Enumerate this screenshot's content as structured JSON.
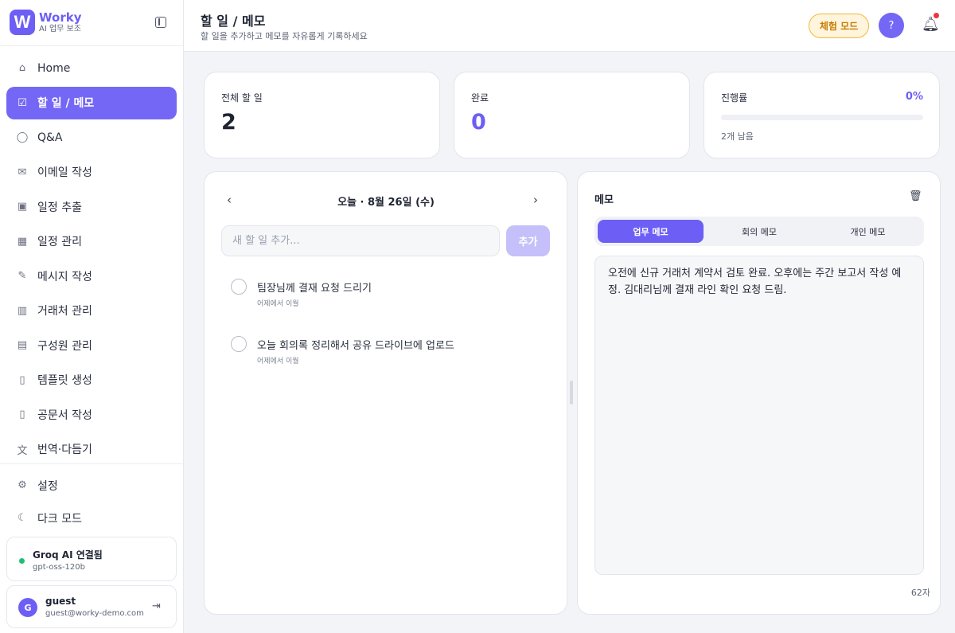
{
  "brand": {
    "logo_letter": "W",
    "name": "Worky",
    "subtitle": "AI 업무 보조"
  },
  "sidebar": {
    "items": [
      {
        "label": "Home",
        "icon": "home-icon",
        "glyph": "⌂"
      },
      {
        "label": "할 일 / 메모",
        "icon": "clipboard-check-icon",
        "glyph": "☑",
        "active": true
      },
      {
        "label": "Q&A",
        "icon": "chat-bubble-icon",
        "glyph": "◯"
      },
      {
        "label": "이메일 작성",
        "icon": "mail-icon",
        "glyph": "✉"
      },
      {
        "label": "일정 추출",
        "icon": "calendar-icon",
        "glyph": "▣"
      },
      {
        "label": "일정 관리",
        "icon": "calendar-plus-icon",
        "glyph": "▦"
      },
      {
        "label": "메시지 작성",
        "icon": "pencil-icon",
        "glyph": "✎"
      },
      {
        "label": "거래처 관리",
        "icon": "building-icon",
        "glyph": "▥"
      },
      {
        "label": "구성원 관리",
        "icon": "contact-card-icon",
        "glyph": "▤"
      },
      {
        "label": "템플릿 생성",
        "icon": "document-icon",
        "glyph": "▯"
      },
      {
        "label": "공문서 작성",
        "icon": "document-text-icon",
        "glyph": "▯"
      },
      {
        "label": "번역·다듬기",
        "icon": "translate-icon",
        "glyph": "文"
      }
    ],
    "bottom_items": [
      {
        "label": "설정",
        "icon": "gear-icon",
        "glyph": "⚙"
      },
      {
        "label": "다크 모드",
        "icon": "moon-icon",
        "glyph": "☾"
      }
    ],
    "ai_status": {
      "title": "Groq AI 연결됨",
      "model": "gpt-oss-120b",
      "color": "#1fbf74"
    },
    "user": {
      "initial": "G",
      "name": "guest",
      "email": "guest@worky-demo.com"
    }
  },
  "header": {
    "title": "할 일 / 메모",
    "subtitle": "할 일을 추가하고 메모를 자유롭게 기록하세요",
    "trial_label": "체험 모드",
    "help_label": "?"
  },
  "stats": {
    "total": {
      "label": "전체 할 일",
      "value": "2"
    },
    "done": {
      "label": "완료",
      "value": "0"
    },
    "progress": {
      "label": "진행률",
      "percent_text": "0%",
      "percent": 0,
      "remaining": "2개 남음"
    }
  },
  "todo": {
    "date_label": "오늘 · 8월 26일 (수)",
    "input_placeholder": "새 할 일 추가...",
    "add_label": "추가",
    "items": [
      {
        "text": "팀장님께 결재 요청 드리기",
        "meta": "어제에서 이월"
      },
      {
        "text": "오늘 회의록 정리해서 공유 드라이브에 업로드",
        "meta": "어제에서 이월"
      }
    ]
  },
  "memo": {
    "title": "메모",
    "tabs": [
      "업무 메모",
      "회의 메모",
      "개인 메모"
    ],
    "active_tab": 0,
    "content": "오전에 신규 거래처 계약서 검토 완료. 오후에는 주간 보고서 작성 예정. 김대리님께 결재 라인 확인 요청 드림.",
    "char_count": "62자"
  },
  "colors": {
    "accent": "#6d5ff5",
    "trial": "#c77d07",
    "notification": "#ef3340"
  }
}
